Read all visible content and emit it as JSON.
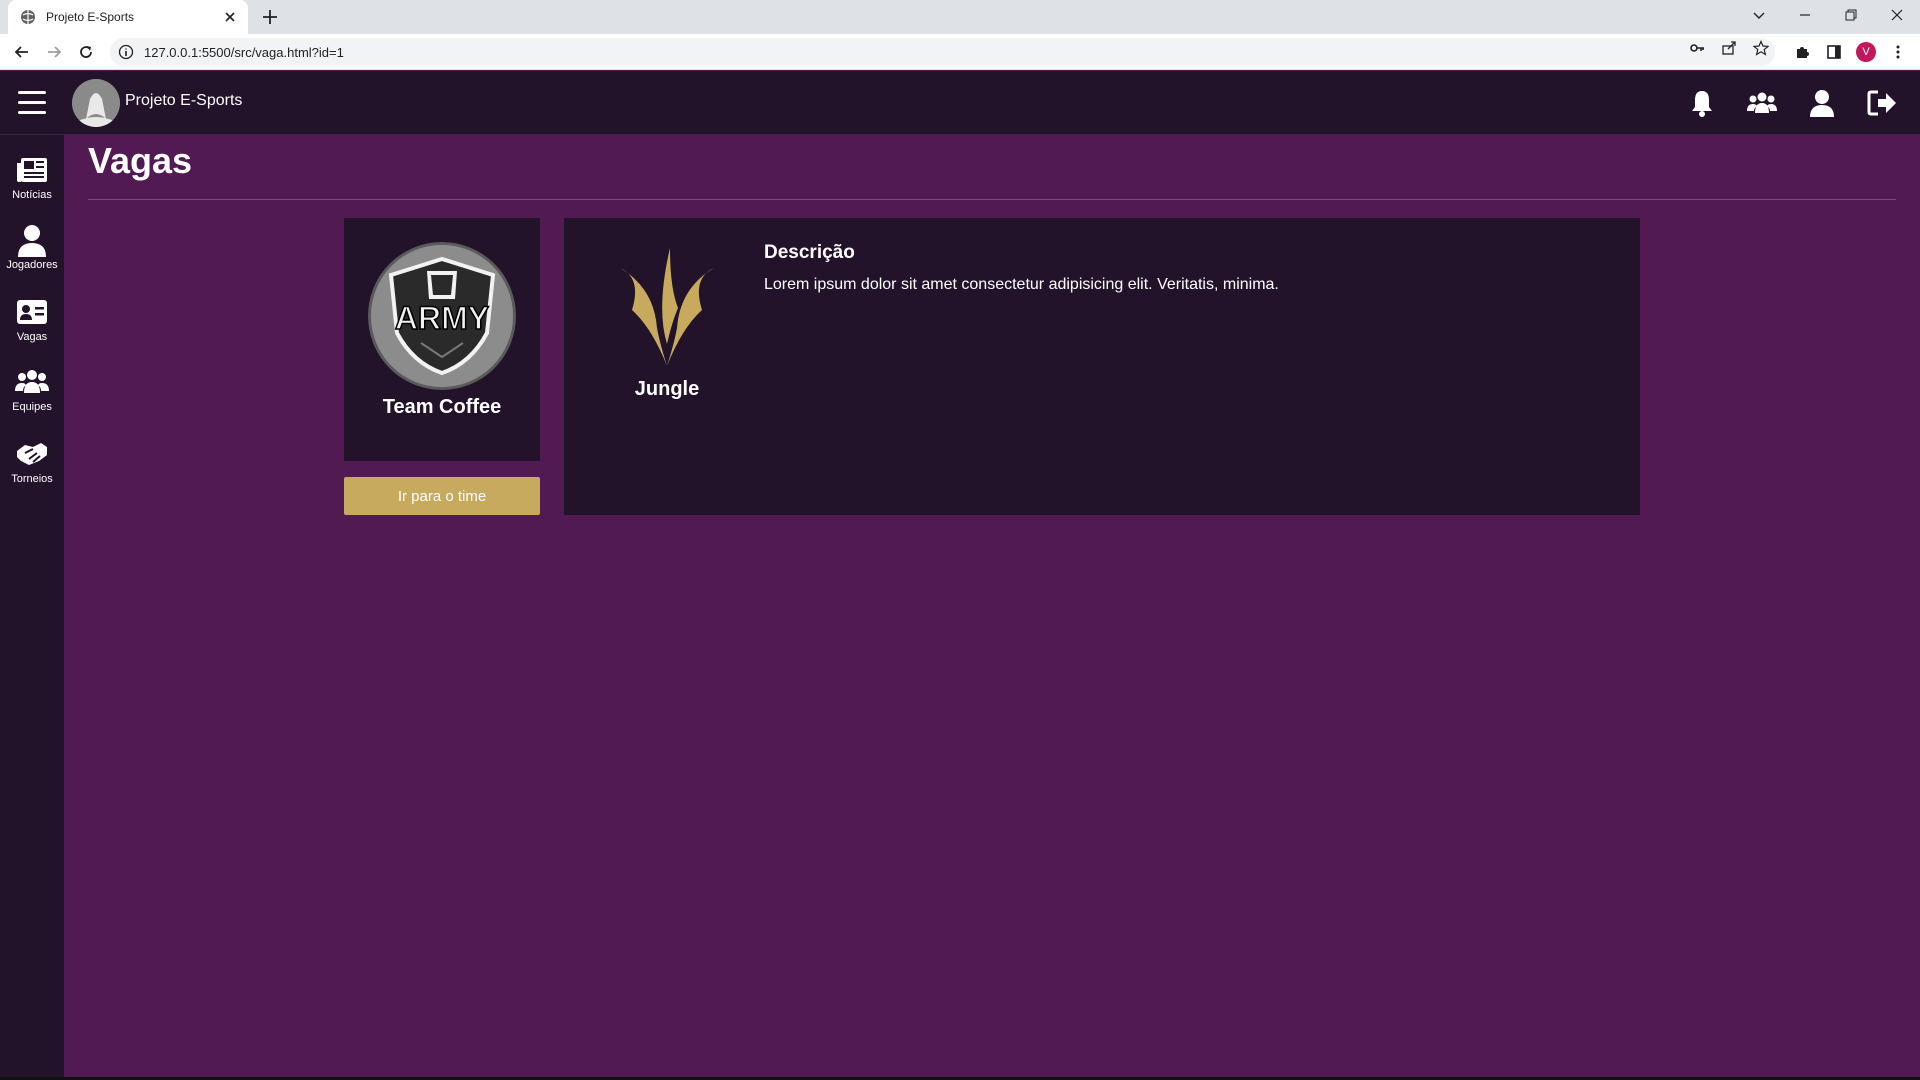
{
  "browser": {
    "tab_title": "Projeto E-Sports",
    "url": "127.0.0.1:5500/src/vaga.html?id=1",
    "profile_initial": "V"
  },
  "app": {
    "brand": "Projeto E-Sports",
    "page_title": "Vagas",
    "accent_color": "#c8aa5e",
    "bg_color": "#521a52",
    "panel_color": "#22122a"
  },
  "header_icons": [
    "bell-icon",
    "users-icon",
    "user-icon",
    "logout-icon"
  ],
  "sidebar": {
    "items": [
      {
        "label": "Notícias",
        "icon": "newspaper-icon"
      },
      {
        "label": "Jogadores",
        "icon": "user-icon"
      },
      {
        "label": "Vagas",
        "icon": "id-card-icon"
      },
      {
        "label": "Equipes",
        "icon": "users-icon"
      },
      {
        "label": "Torneios",
        "icon": "handshake-icon"
      }
    ]
  },
  "team": {
    "name": "Team Coffee",
    "logo_text": "ARMY",
    "button_label": "Ir para o time"
  },
  "vacancy": {
    "role": "Jungle",
    "description_title": "Descrição",
    "description": "Lorem ipsum dolor sit amet consectetur adipisicing elit. Veritatis, minima."
  }
}
